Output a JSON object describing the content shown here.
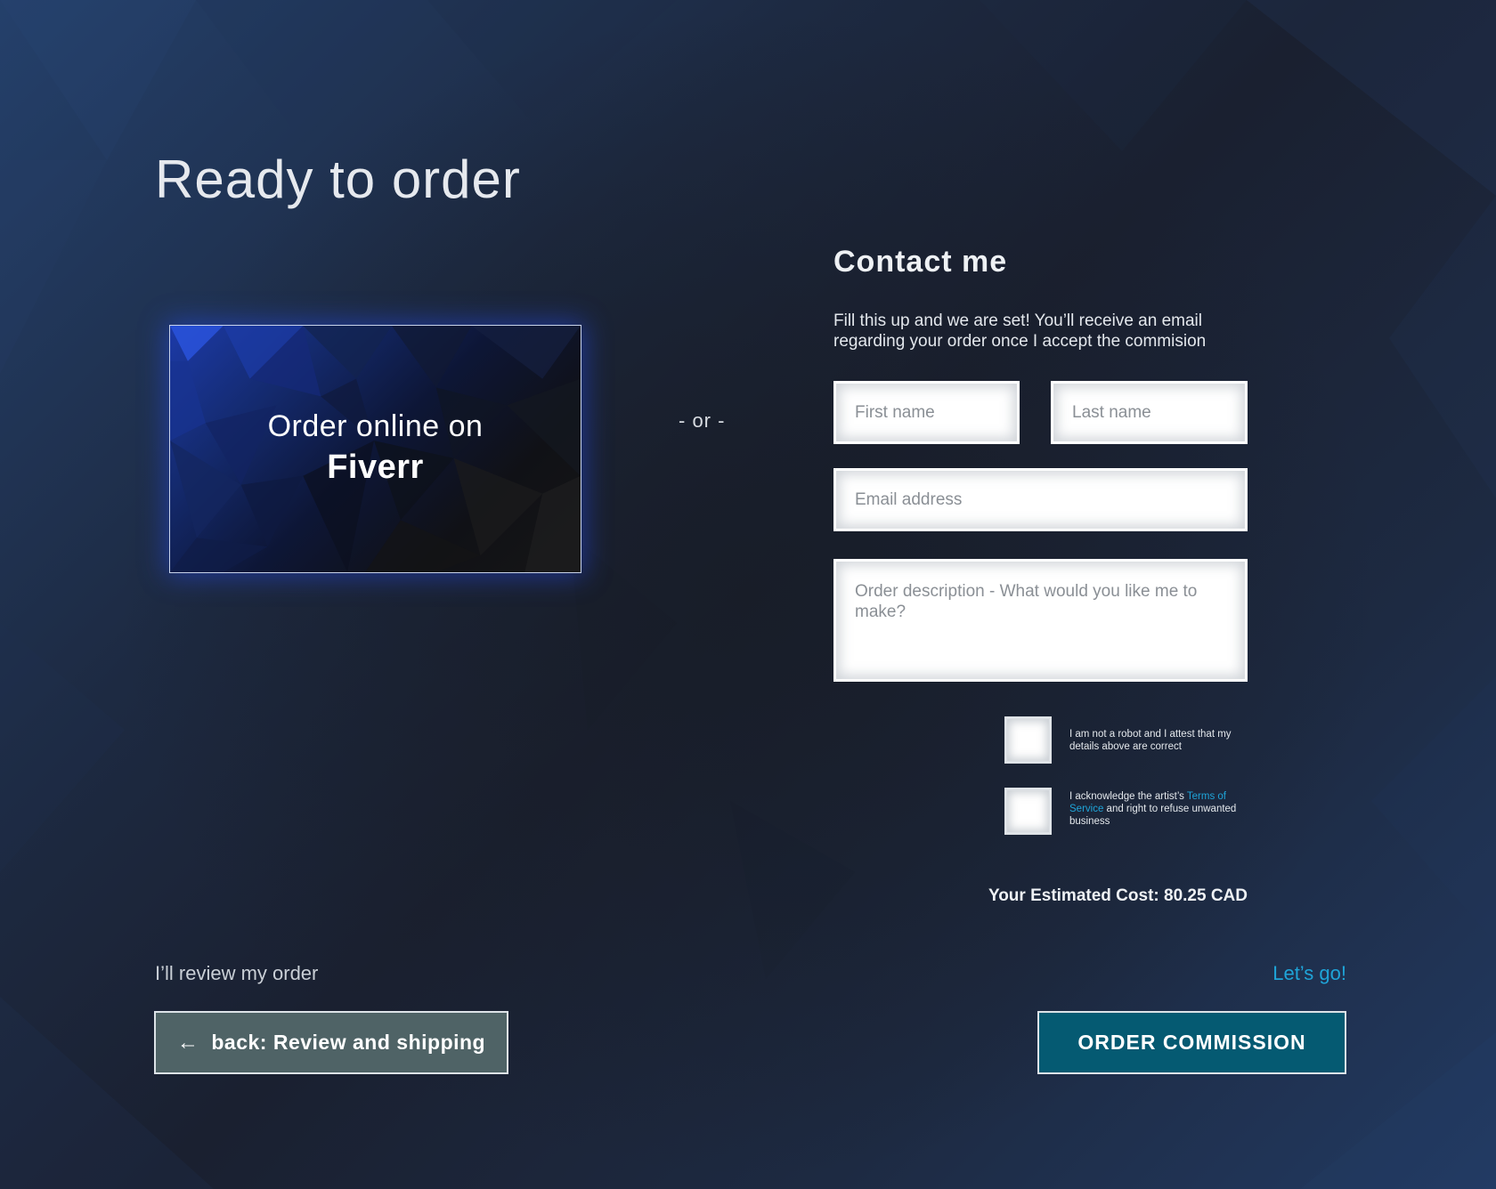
{
  "page": {
    "title": "Ready to order"
  },
  "fiverr_card": {
    "line1": "Order online on",
    "line2": "Fiverr"
  },
  "divider": {
    "text": "- or -"
  },
  "contact": {
    "title": "Contact me",
    "intro": "Fill this up and we are set! You’ll receive an email regarding your order once I accept the commision",
    "first_name_placeholder": "First name",
    "last_name_placeholder": "Last name",
    "email_placeholder": "Email address",
    "description_placeholder": "Order description - What would you like me to make?"
  },
  "checkboxes": {
    "robot_label": "I am not a robot and I attest that my details above are correct",
    "terms_prefix": "I acknowledge the artist’s ",
    "terms_link": "Terms of Service",
    "terms_suffix": " and right to refuse unwanted business"
  },
  "cost": {
    "text": "Your Estimated Cost: 80.25 CAD"
  },
  "footer": {
    "review_label": "I’ll review my order",
    "back_button_arrow": "←",
    "back_button_label": "back: Review and shipping",
    "letsgo_label": "Let’s go!",
    "order_button_label": "ORDER COMMISSION"
  },
  "colors": {
    "accent": "#1fa4d8",
    "order_button": "#055a72",
    "back_button": "#4f6366"
  },
  "icons": {
    "back_arrow": "left-arrow-icon"
  }
}
